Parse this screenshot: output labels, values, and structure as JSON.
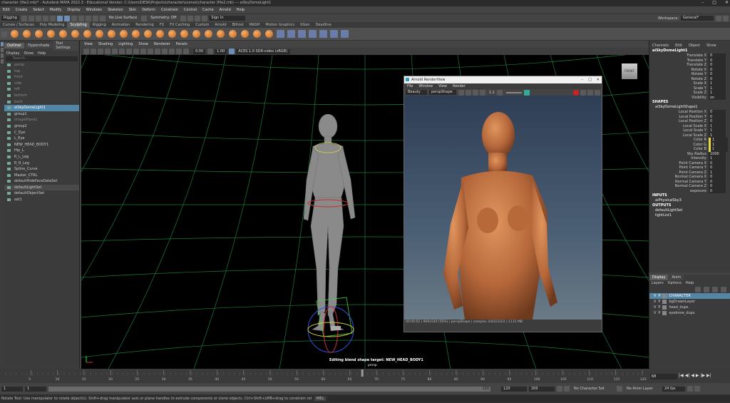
{
  "titlebar": {
    "title": "character (file2.mb)* - Autodesk MAYA 2022.3 - Educational Version: C:\\Users\\DESK\\Projects\\character\\scenes\\character (file2.mb) --- aiSkyDomeLight1"
  },
  "menubar": [
    "Edit",
    "Create",
    "Select",
    "Modify",
    "Display",
    "Windows",
    "Skeleton",
    "Skin",
    "Deform",
    "Constrain",
    "Control",
    "Cache",
    "Arnold",
    "Help"
  ],
  "statusline": {
    "mode_value": "Rigging",
    "live_surface": "No Live Surface",
    "symmetry": "Symmetry: Off",
    "signin": "Sign In",
    "workspace_label": "Workspace:",
    "workspace_value": "General*"
  },
  "shelftabs": [
    "Curves / Surfaces",
    "Poly Modeling",
    "Sculpting",
    "Rigging",
    "Animation",
    "Rendering",
    "FX",
    "FX Caching",
    "Custom",
    "Arnold",
    "Bifrost",
    "MASH",
    "Motion Graphics",
    "XGen",
    "Deadline"
  ],
  "shelftabs_active": "Sculpting",
  "outliner": {
    "tabs": [
      "Outliner",
      "Hypershade",
      "Tool Settings"
    ],
    "menu": [
      "Display",
      "Show",
      "Help"
    ],
    "search_placeholder": "Search...",
    "items": [
      {
        "name": "persp",
        "dim": true
      },
      {
        "name": "top",
        "dim": true
      },
      {
        "name": "front",
        "dim": true
      },
      {
        "name": "side",
        "dim": true
      },
      {
        "name": "left",
        "dim": true
      },
      {
        "name": "bottom",
        "dim": true
      },
      {
        "name": "back",
        "dim": true
      },
      {
        "name": "aiSkyDomeLight1",
        "sel": true
      },
      {
        "name": "group1"
      },
      {
        "name": "imagePlane1",
        "dim": true
      },
      {
        "name": "group2"
      },
      {
        "name": "C_Eye"
      },
      {
        "name": "L_Eye"
      },
      {
        "name": "NEW_HEAD_BODY1"
      },
      {
        "name": "Hip_L"
      },
      {
        "name": "R_L_Leg"
      },
      {
        "name": "R_R_Leg"
      },
      {
        "name": "Spline_Curve"
      },
      {
        "name": "Master_CTRL"
      },
      {
        "name": "defaultHideFaceDataSet"
      },
      {
        "name": "defaultLightSet",
        "sel2": true
      },
      {
        "name": "defaultObjectSet"
      },
      {
        "name": "set1"
      }
    ]
  },
  "viewport": {
    "menu": [
      "View",
      "Shading",
      "Lighting",
      "Show",
      "Renderer",
      "Panels"
    ],
    "field1": "0.00",
    "field2": "1.00",
    "colorspace": "ACES 1.0 SDR-video (sRGB)",
    "front_label": "FRONT",
    "hud_label": "Editing blend shape target:",
    "hud_target": "NEW_HEAD_BODY1",
    "camera_label": "persp"
  },
  "renderview": {
    "title": "Arnold RenderView",
    "menu": [
      "File",
      "Window",
      "View",
      "Render"
    ],
    "mode": "Beauty",
    "camera": "perspShape",
    "zoom": "1:1",
    "status": "00:00:02 | 960x540 (50%) | perspShape | samples 3/4/2/2/2/2 | 1131 MB"
  },
  "channelbox": {
    "tabs": [
      "Channels",
      "Edit",
      "Object",
      "Show"
    ],
    "object": "aiSkyDomeLight1",
    "transform": [
      {
        "n": "Translate X",
        "v": "0"
      },
      {
        "n": "Translate Y",
        "v": "0"
      },
      {
        "n": "Translate Z",
        "v": "0"
      },
      {
        "n": "Rotate X",
        "v": "0"
      },
      {
        "n": "Rotate Y",
        "v": "0"
      },
      {
        "n": "Rotate Z",
        "v": "0"
      },
      {
        "n": "Scale X",
        "v": "1"
      },
      {
        "n": "Scale Y",
        "v": "1"
      },
      {
        "n": "Scale Z",
        "v": "1"
      },
      {
        "n": "Visibility",
        "v": "on"
      }
    ],
    "shapes_label": "SHAPES",
    "shape_name": "aiSkyDomeLightShape1",
    "shape_attrs": [
      {
        "n": "Local Position X",
        "v": "0"
      },
      {
        "n": "Local Position Y",
        "v": "0"
      },
      {
        "n": "Local Position Z",
        "v": "0"
      },
      {
        "n": "Local Scale X",
        "v": "1"
      },
      {
        "n": "Local Scale Y",
        "v": "1"
      },
      {
        "n": "Local Scale Z",
        "v": "1"
      },
      {
        "n": "Color R",
        "v": "1"
      },
      {
        "n": "Color G",
        "v": "1"
      },
      {
        "n": "Color B",
        "v": "1"
      },
      {
        "n": "Sky Radius",
        "v": "1000"
      },
      {
        "n": "Intensity",
        "v": "1"
      },
      {
        "n": "Point Camera X",
        "v": "0"
      },
      {
        "n": "Point Camera Y",
        "v": "0"
      },
      {
        "n": "Point Camera Z",
        "v": "1"
      },
      {
        "n": "Normal Camera X",
        "v": "0"
      },
      {
        "n": "Normal Camera Y",
        "v": "0"
      },
      {
        "n": "Normal Camera Z",
        "v": "0"
      },
      {
        "n": "exposure",
        "v": "0"
      }
    ],
    "inputs_label": "INPUTS",
    "input1": "aiPhysicalSky3",
    "outputs_label": "OUTPUTS",
    "output1": "defaultLightSet",
    "output2": "lightList1"
  },
  "layers": {
    "tabs": [
      "Display",
      "Anim"
    ],
    "menu": [
      "Layers",
      "Options",
      "Help"
    ],
    "items": [
      {
        "v": "V",
        "p": "P",
        "name": "CHARACTER",
        "sel": true
      },
      {
        "v": "V",
        "p": "P",
        "name": "bgDrawnLayer"
      },
      {
        "v": "V",
        "p": "P",
        "name": "head_dups"
      },
      {
        "v": "V",
        "p": "P",
        "name": "eyebrow_dups"
      }
    ]
  },
  "timeline": {
    "current": "68",
    "ticks": [
      "5",
      "10",
      "15",
      "20",
      "25",
      "30",
      "35",
      "40",
      "45",
      "50",
      "55",
      "60",
      "65",
      "70",
      "75",
      "80",
      "85",
      "90",
      "95",
      "100",
      "105",
      "110",
      "115",
      "120"
    ]
  },
  "range": {
    "start": "1",
    "start2": "1",
    "end": "120",
    "end2": "120",
    "max": "200",
    "character": "No Character Set",
    "anim_layer": "No Anim Layer",
    "fps": "24 fps"
  },
  "helpline": {
    "text": "Rotate Tool: Use manipulator to rotate object(s). Shift+drag manipulator axis or plane handles to extrude components or clone objects. Ctrl+Shift+LMB+drag to constrain rotation to connected edges. Use D or INSERT to change the piv",
    "mel": "MEL"
  },
  "colors": {
    "accent": "#5285a6",
    "grid": "#1c7a3c",
    "skin": "#c07040",
    "gray_model": "#8a8a8a"
  }
}
